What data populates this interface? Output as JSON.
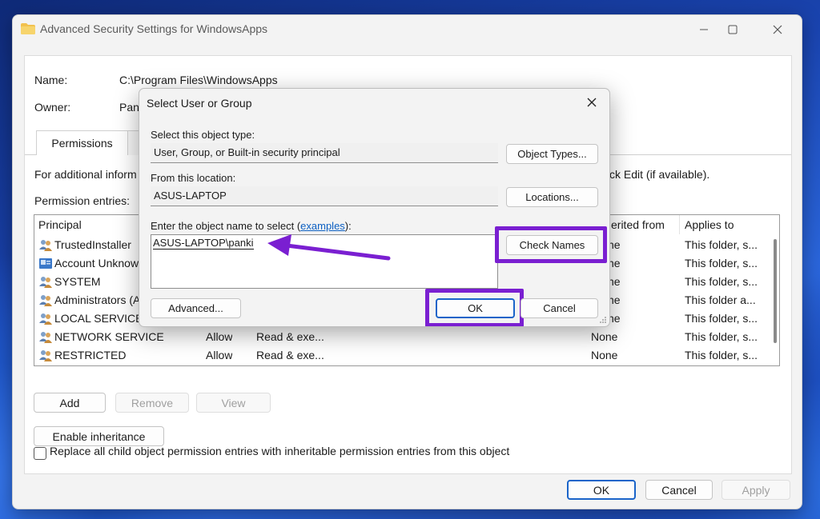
{
  "window": {
    "title": "Advanced Security Settings for WindowsApps",
    "name_label": "Name:",
    "name_value": "C:\\Program Files\\WindowsApps",
    "owner_label": "Owner:",
    "owner_value": "Pank",
    "tab_permissions": "Permissions",
    "info_text": "For additional inform",
    "info_text_tail": "ck Edit (if available).",
    "entries_label": "Permission entries:",
    "columns": {
      "principal": "Principal",
      "inherited": "erited from",
      "applies": "Applies to"
    },
    "rows": [
      {
        "principal": "TrustedInstaller",
        "type": "",
        "access": "",
        "inherited": "ne",
        "applies": "This folder, s..."
      },
      {
        "principal": "Account Unknow",
        "type": "",
        "access": "",
        "inherited": "ne",
        "applies": "This folder, s..."
      },
      {
        "principal": "SYSTEM",
        "type": "",
        "access": "",
        "inherited": "ne",
        "applies": "This folder, s..."
      },
      {
        "principal": "Administrators (A",
        "type": "",
        "access": "",
        "inherited": "ne",
        "applies": "This folder a..."
      },
      {
        "principal": "LOCAL SERVICE",
        "type": "",
        "access": "",
        "inherited": "ne",
        "applies": "This folder, s..."
      },
      {
        "principal": "NETWORK SERVICE",
        "type": "Allow",
        "access": "Read & exe...",
        "inherited": "None",
        "applies": "This folder, s..."
      },
      {
        "principal": "RESTRICTED",
        "type": "Allow",
        "access": "Read & exe...",
        "inherited": "None",
        "applies": "This folder, s..."
      }
    ],
    "add": "Add",
    "remove": "Remove",
    "view": "View",
    "enable_inheritance": "Enable inheritance",
    "replace_label": "Replace all child object permission entries with inheritable permission entries from this object",
    "ok": "OK",
    "cancel": "Cancel",
    "apply": "Apply"
  },
  "dialog": {
    "title": "Select User or Group",
    "object_type_label": "Select this object type:",
    "object_type_value": "User, Group, or Built-in security principal",
    "object_types_button": "Object Types...",
    "location_label": "From this location:",
    "location_value": "ASUS-LAPTOP",
    "locations_button": "Locations...",
    "enter_label_prefix": "Enter the object name to select (",
    "enter_label_link": "examples",
    "enter_label_suffix": "):",
    "object_name_value": "ASUS-LAPTOP\\panki",
    "check_names_button": "Check Names",
    "advanced_button": "Advanced...",
    "ok_button": "OK",
    "cancel_button": "Cancel"
  },
  "colors": {
    "highlight": "#7a1fd1",
    "arrow": "#7a1fd1",
    "accent": "#1a64c9"
  }
}
